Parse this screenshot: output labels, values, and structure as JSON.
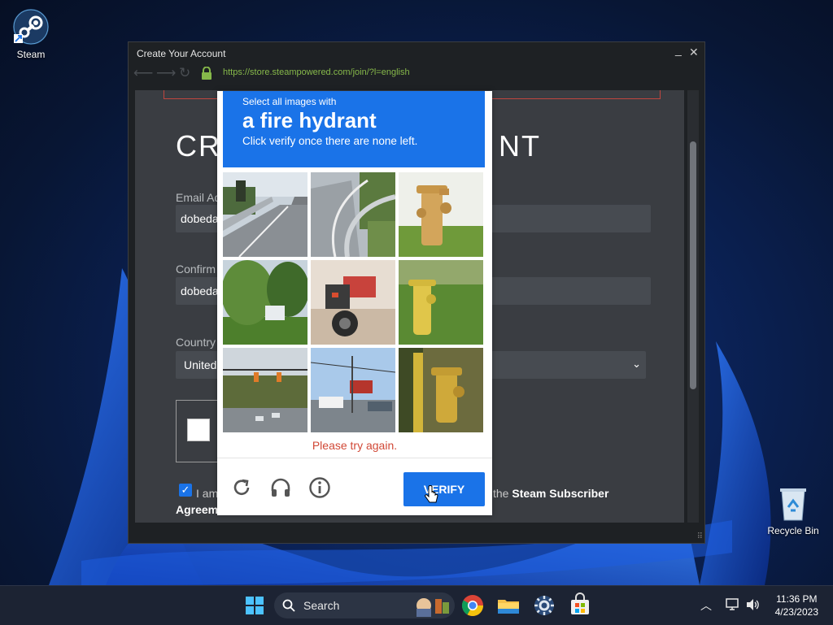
{
  "desktop": {
    "icons": [
      {
        "label": "Steam"
      },
      {
        "label": "Recycle Bin"
      }
    ]
  },
  "window": {
    "title": "Create Your Account",
    "url": "https://store.steampowered.com/join/?l=english",
    "controls": {
      "minimize": "_",
      "close": "✕"
    }
  },
  "form": {
    "heading_left": "CRE",
    "heading_right": "NT",
    "email_label": "Email Ad",
    "email_value": "dobeda",
    "confirm_label": "Confirm",
    "confirm_value": "dobeda",
    "country_label": "Country",
    "country_value": "United",
    "agree_text": "I am",
    "agree_right_prefix": "the",
    "agree_right_link": "Steam Subscriber",
    "agree_line2": "Agreem"
  },
  "captcha": {
    "line1": "Select all images with",
    "target": "a fire hydrant",
    "line3": "Click verify once there are none left.",
    "error": "Please try again.",
    "verify_label": "VERIFY",
    "tiles": [
      {
        "subject": "highway-road"
      },
      {
        "subject": "road-guardrail"
      },
      {
        "subject": "fire-hydrant"
      },
      {
        "subject": "trees-house"
      },
      {
        "subject": "motorcycle"
      },
      {
        "subject": "fire-hydrant"
      },
      {
        "subject": "traffic-street"
      },
      {
        "subject": "street-signs"
      },
      {
        "subject": "fire-hydrant"
      }
    ]
  },
  "taskbar": {
    "search_label": "Search",
    "time": "11:36 PM",
    "date": "4/23/2023"
  },
  "colors": {
    "accent": "#1a73e8",
    "error": "#d14836",
    "url": "#86b84a"
  }
}
